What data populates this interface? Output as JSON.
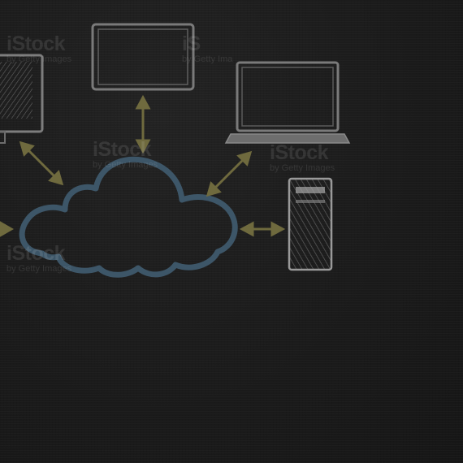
{
  "scene": {
    "title": "",
    "colors": {
      "background": "#1c1c1c",
      "chalk_white": "#8f8f8f",
      "cloud_blue": "#3d5668",
      "arrow_olive": "#6f6a3e"
    },
    "devices": [
      {
        "name": "monitor-left",
        "icon": "monitor-icon"
      },
      {
        "name": "tablet-top",
        "icon": "tablet-icon"
      },
      {
        "name": "laptop-right",
        "icon": "laptop-icon"
      },
      {
        "name": "tower-pc",
        "icon": "desktop-tower-icon"
      },
      {
        "name": "cloud-center",
        "icon": "cloud-icon"
      }
    ],
    "watermarks": [
      {
        "logo": "iStock",
        "sub": "by Getty Images"
      },
      {
        "logo": "iS",
        "sub": "by Getty Ima"
      },
      {
        "logo": "iStock",
        "sub": "by Getty Images"
      },
      {
        "logo": "iStock",
        "sub": "by Getty Images"
      },
      {
        "logo": "iStock",
        "sub": "by Getty Images"
      }
    ]
  }
}
